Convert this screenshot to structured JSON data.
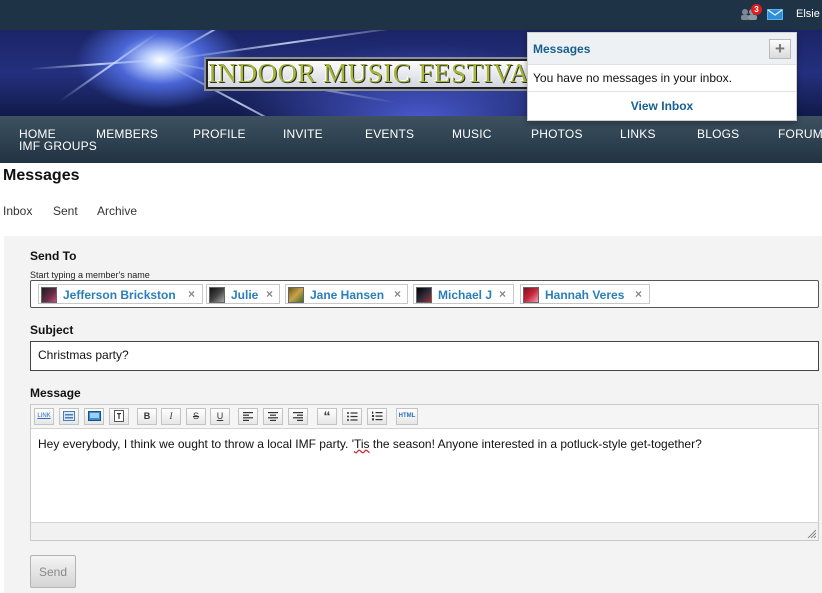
{
  "topbar": {
    "notifications_count": "3",
    "user_name": "Elsie"
  },
  "banner": {
    "title": "INDOOR MUSIC FESTIVAL"
  },
  "nav": {
    "items": [
      {
        "label": "HOME"
      },
      {
        "label": "MEMBERS"
      },
      {
        "label": "PROFILE"
      },
      {
        "label": "INVITE"
      },
      {
        "label": "EVENTS"
      },
      {
        "label": "MUSIC"
      },
      {
        "label": "PHOTOS"
      },
      {
        "label": "LINKS"
      },
      {
        "label": "BLOGS"
      },
      {
        "label": "FORUMS"
      },
      {
        "label": "IMF GROUPS"
      }
    ]
  },
  "page": {
    "title": "Messages"
  },
  "subnav": {
    "items": [
      {
        "label": "Inbox"
      },
      {
        "label": "Sent"
      },
      {
        "label": "Archive"
      }
    ]
  },
  "form": {
    "send_to_label": "Send To",
    "send_to_hint": "Start typing a member's name",
    "recipients": [
      {
        "name": "Jefferson Brickston"
      },
      {
        "name": "Julie"
      },
      {
        "name": "Jane Hansen"
      },
      {
        "name": "Michael J"
      },
      {
        "name": "Hannah Veres"
      }
    ],
    "remove_glyph": "×",
    "subject_label": "Subject",
    "subject_value": "Christmas party?",
    "message_label": "Message",
    "message_before": "Hey everybody, I think we ought to throw a local IMF party.  '",
    "message_misspelled": "Tis",
    "message_after": " the season!  Anyone interested in a potluck-style get-together?",
    "send_label": "Send"
  },
  "toolbar": {
    "link": "LINK",
    "bold": "B",
    "italic": "I",
    "strike": "S",
    "underline": "U",
    "quote": "“",
    "html": "HTML"
  },
  "messages_popover": {
    "title": "Messages",
    "add_symbol": "+",
    "empty_text": "You have no messages in your inbox.",
    "view_inbox": "View Inbox"
  },
  "colors": {
    "link": "#2a7fb8",
    "popover_title": "#17608f",
    "badge": "#d9201c",
    "topbar": "#1f3346"
  }
}
